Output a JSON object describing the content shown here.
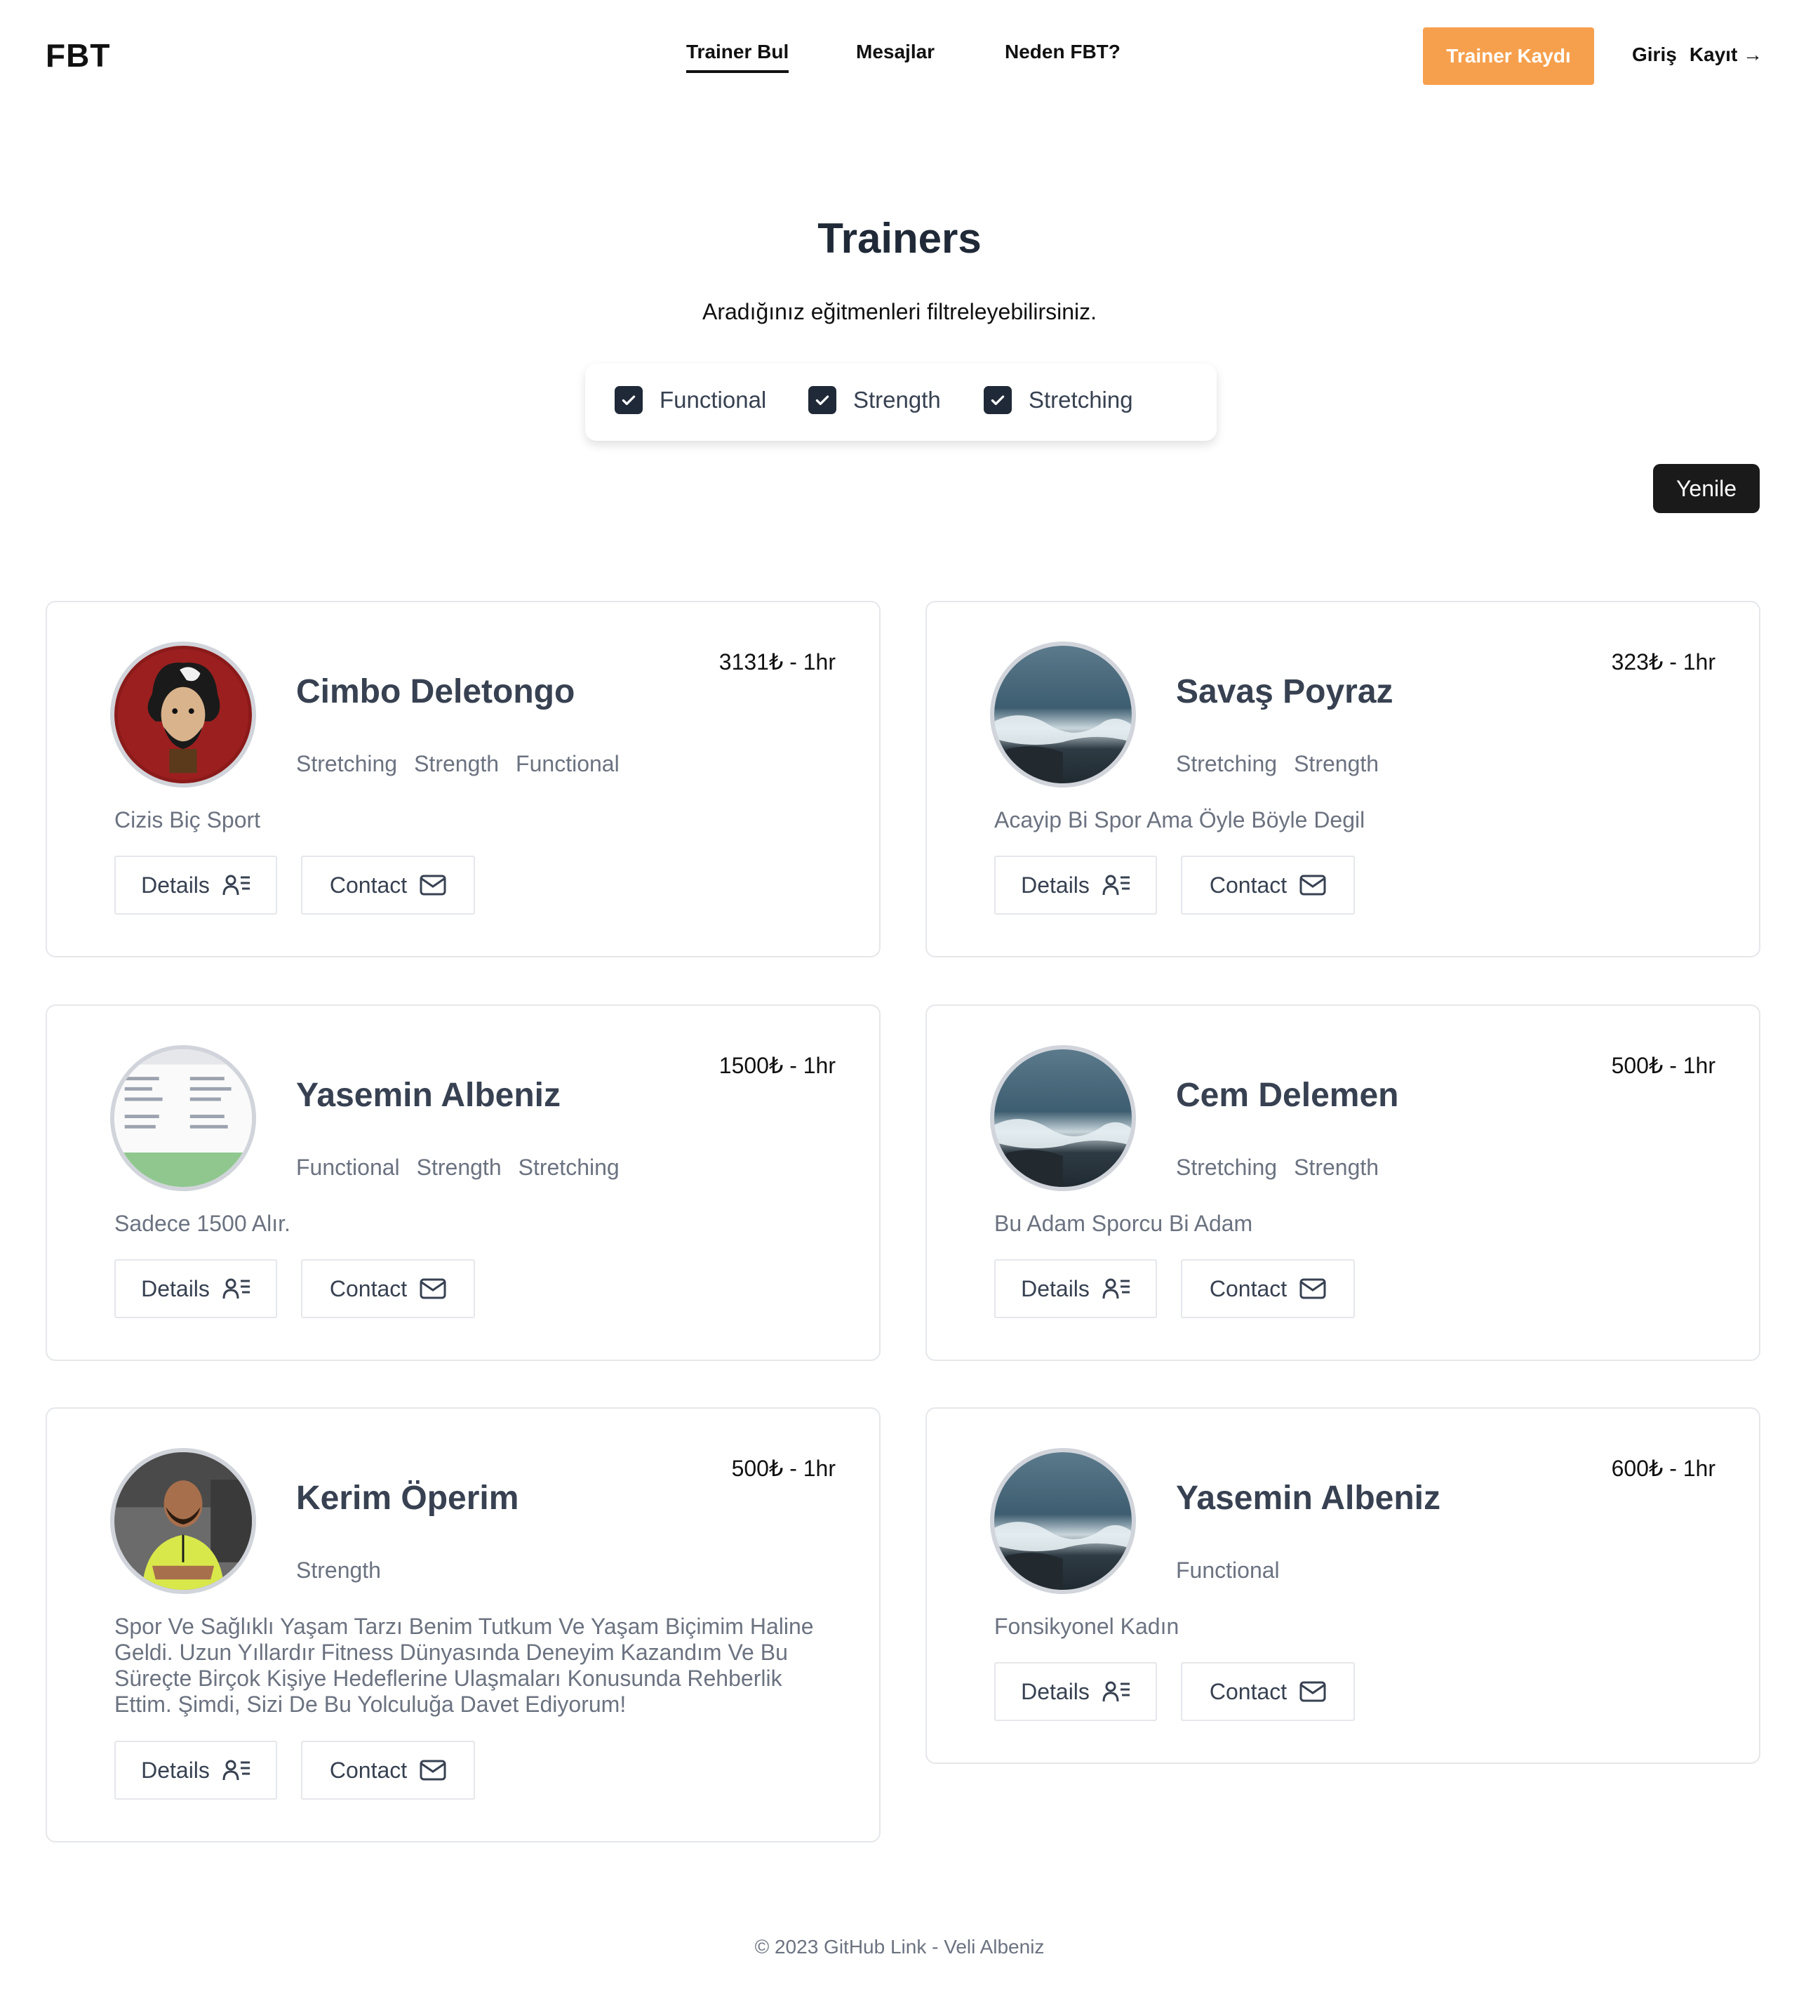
{
  "header": {
    "logo": "FBT",
    "nav": [
      {
        "label": "Trainer Bul",
        "active": true
      },
      {
        "label": "Mesajlar",
        "active": false
      },
      {
        "label": "Neden FBT?",
        "active": false
      }
    ],
    "trainer_register_label": "Trainer Kaydı",
    "login_label": "Giriş",
    "signup_label": "Kayıt →",
    "accent_color": "#f6a04d"
  },
  "hero": {
    "title": "Trainers",
    "subtitle": "Aradığınız eğitmenleri filtreleyebilirsiniz."
  },
  "filters": [
    {
      "label": "Functional",
      "checked": true
    },
    {
      "label": "Strength",
      "checked": true
    },
    {
      "label": "Stretching",
      "checked": true
    }
  ],
  "refresh_label": "Yenile",
  "buttons": {
    "details_label": "Details",
    "contact_label": "Contact"
  },
  "trainers": [
    {
      "name": "Cimbo Deletongo",
      "price": "3131₺ - 1hr",
      "tags": [
        "Stretching",
        "Strength",
        "Functional"
      ],
      "description": "Cizis Biç Sport",
      "avatar": "cartoon-portrait"
    },
    {
      "name": "Savaş Poyraz",
      "price": "323₺ - 1hr",
      "tags": [
        "Stretching",
        "Strength"
      ],
      "description": "Acayip Bi Spor Ama Öyle Böyle Degil",
      "avatar": "ocean-wave"
    },
    {
      "name": "Yasemin Albeniz",
      "price": "1500₺ - 1hr",
      "tags": [
        "Functional",
        "Strength",
        "Stretching"
      ],
      "description": "Sadece 1500 Alır.",
      "avatar": "app-screenshot"
    },
    {
      "name": "Cem Delemen",
      "price": "500₺ - 1hr",
      "tags": [
        "Stretching",
        "Strength"
      ],
      "description": "Bu Adam Sporcu Bi Adam",
      "avatar": "ocean-wave"
    },
    {
      "name": "Kerim Öperim",
      "price": "500₺ - 1hr",
      "tags": [
        "Strength"
      ],
      "description": "Spor Ve Sağlıklı Yaşam Tarzı Benim Tutkum Ve Yaşam Biçimim Haline Geldi. Uzun Yıllardır Fitness Dünyasında Deneyim Kazandım Ve Bu Süreçte Birçok Kişiye Hedeflerine Ulaşmaları Konusunda Rehberlik Ettim. Şimdi, Sizi De Bu Yolculuğa Davet Ediyorum!",
      "avatar": "gym-photo"
    },
    {
      "name": "Yasemin Albeniz",
      "price": "600₺ - 1hr",
      "tags": [
        "Functional"
      ],
      "description": "Fonsikyonel Kadın",
      "avatar": "ocean-wave"
    }
  ],
  "footer": "© 2023 GitHub Link - Veli Albeniz"
}
